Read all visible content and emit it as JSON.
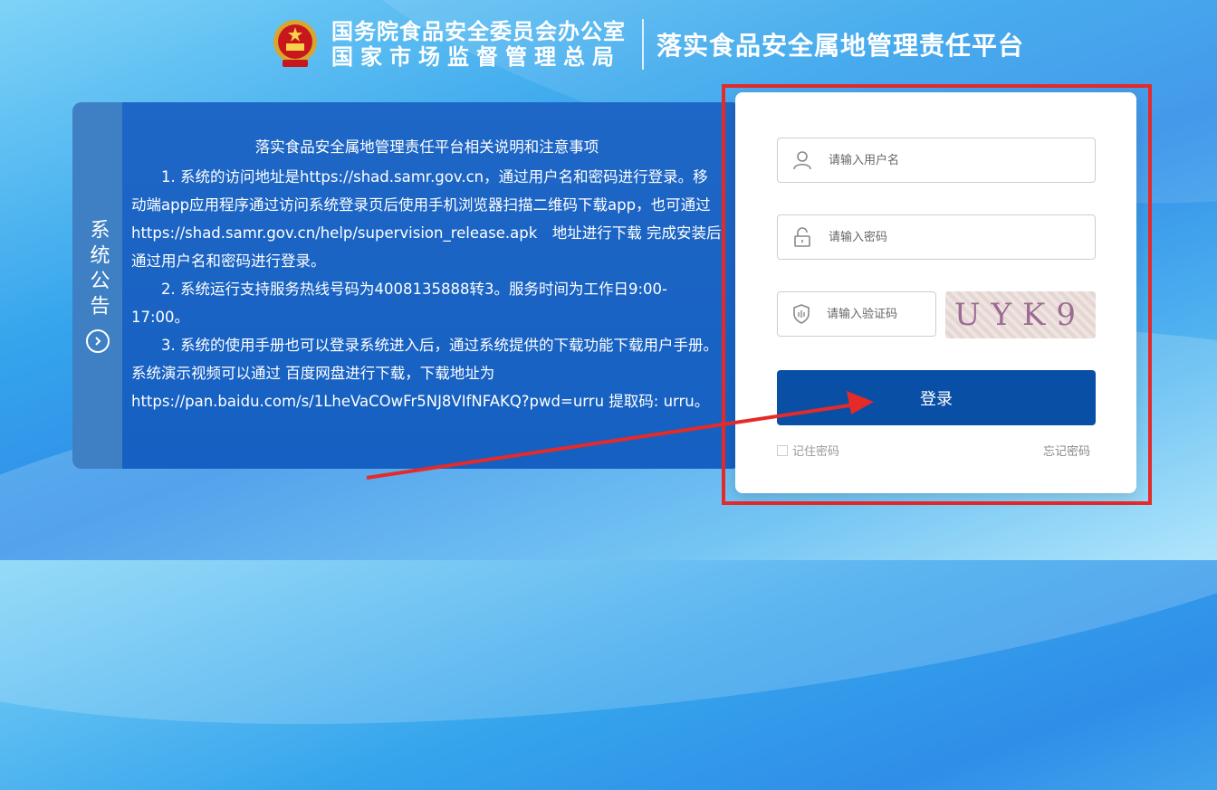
{
  "header": {
    "org_line1": "国务院食品安全委员会办公室",
    "org_line2": "国家市场监督管理总局",
    "platform_title": "落实食品安全属地管理责任平台"
  },
  "notice": {
    "tab_label": "系统公告",
    "arrow_icon": "circle-chevron-right-icon",
    "title": "落实食品安全属地管理责任平台相关说明和注意事项",
    "p1": "1. 系统的访问地址是https://shad.samr.gov.cn，通过用户名和密码进行登录。移动端app应用程序通过访问系统登录页后使用手机浏览器扫描二维码下载app，也可通过　https://shad.samr.gov.cn/help/supervision_release.apk　地址进行下载 完成安装后通过用户名和密码进行登录。",
    "p2": "2. 系统运行支持服务热线号码为4008135888转3。服务时间为工作日9:00-17:00。",
    "p3": "3. 系统的使用手册也可以登录系统进入后，通过系统提供的下载功能下载用户手册。系统演示视频可以通过 百度网盘进行下载，下载地址为",
    "p4": "https://pan.baidu.com/s/1LheVaCOwFr5NJ8VIfNFAKQ?pwd=urru  提取码: urru。"
  },
  "login": {
    "username_placeholder": "请输入用户名",
    "password_placeholder": "请输入密码",
    "captcha_placeholder": "请输入验证码",
    "captcha_text": "UYK9",
    "login_label": "登录",
    "remember_label": "记住密码",
    "forgot_label": "忘记密码"
  },
  "colors": {
    "primary_button": "#0a4fa6",
    "annotation_red": "#e52a2a",
    "notice_bg": "#1560c2"
  }
}
